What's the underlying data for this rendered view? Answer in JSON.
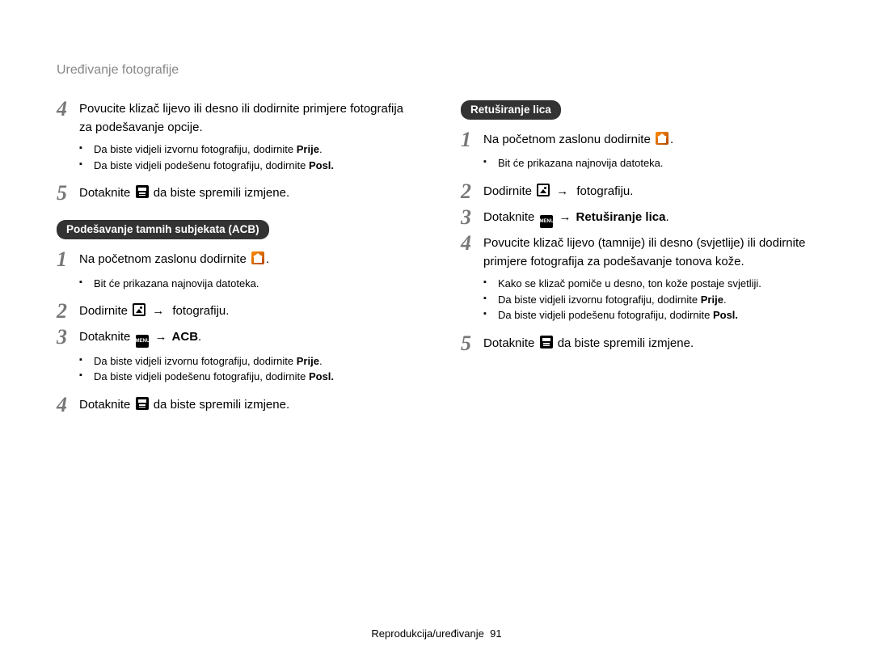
{
  "header": "Uređivanje fotografije",
  "arrow": "→",
  "footer": {
    "section": "Reprodukcija/uređivanje",
    "page": "91"
  },
  "left": {
    "s4": {
      "n": "4",
      "text": "Povucite klizač lijevo ili desno ili dodirnite primjere fotografija za podešavanje opcije.",
      "b1_pre": "Da biste vidjeli izvornu fotografiju, dodirnite ",
      "b1_bold": "Prije",
      "b2_pre": "Da biste vidjeli podešenu fotografiju, dodirnite ",
      "b2_bold": "Posl."
    },
    "s5": {
      "n": "5",
      "pre": "Dotaknite ",
      "post": " da biste spremili izmjene."
    },
    "pill1": "Podešavanje tamnih subjekata (ACB)",
    "a1": {
      "n": "1",
      "pre": "Na početnom zaslonu dodirnite ",
      "post": ".",
      "b1": "Bit će prikazana najnovija datoteka."
    },
    "a2": {
      "n": "2",
      "pre": "Dodirnite ",
      "mid": " fotografiju."
    },
    "a3": {
      "n": "3",
      "pre": "Dotaknite ",
      "bold": "ACB",
      "dot": ".",
      "b1_pre": "Da biste vidjeli izvornu fotografiju, dodirnite ",
      "b1_bold": "Prije",
      "b2_pre": "Da biste vidjeli podešenu fotografiju, dodirnite ",
      "b2_bold": "Posl."
    },
    "a4": {
      "n": "4",
      "pre": "Dotaknite ",
      "post": " da biste spremili izmjene."
    }
  },
  "right": {
    "pill": "Retuširanje lica",
    "r1": {
      "n": "1",
      "pre": "Na početnom zaslonu dodirnite ",
      "post": ".",
      "b1": "Bit će prikazana najnovija datoteka."
    },
    "r2": {
      "n": "2",
      "pre": "Dodirnite ",
      "mid": " fotografiju."
    },
    "r3": {
      "n": "3",
      "pre": "Dotaknite ",
      "bold": "Retuširanje lica",
      "dot": "."
    },
    "r4": {
      "n": "4",
      "text": "Povucite klizač lijevo (tamnije) ili desno (svjetlije) ili dodirnite primjere fotografija za podešavanje tonova kože.",
      "b0": "Kako se klizač pomiče u desno, ton kože postaje svjetliji.",
      "b1_pre": "Da biste vidjeli izvornu fotografiju, dodirnite ",
      "b1_bold": "Prije",
      "b2_pre": "Da biste vidjeli podešenu fotografiju, dodirnite ",
      "b2_bold": "Posl."
    },
    "r5": {
      "n": "5",
      "pre": "Dotaknite ",
      "post": " da biste spremili izmjene."
    }
  },
  "menu_label": "MENU"
}
